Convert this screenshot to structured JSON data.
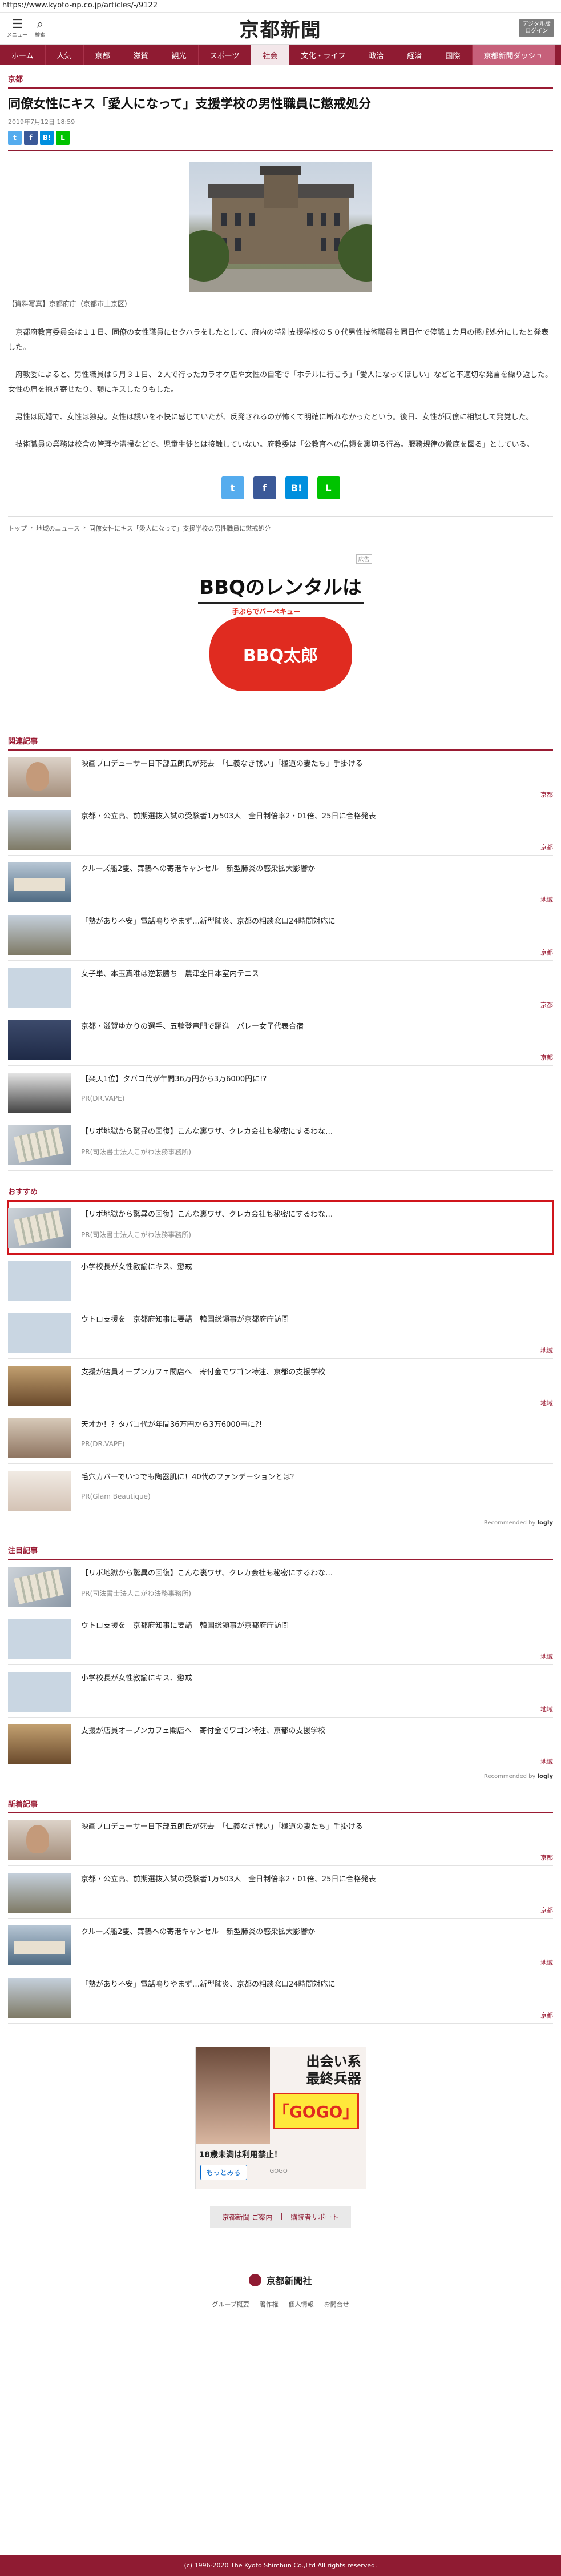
{
  "url": "https://www.kyoto-np.co.jp/articles/-/9122",
  "header": {
    "menu_label": "メニュー",
    "search_label": "検索",
    "logo": "京都新聞",
    "digital_label_1": "デジタル版",
    "digital_label_2": "ログイン"
  },
  "nav": [
    "ホーム",
    "人気",
    "京都",
    "滋賀",
    "観光",
    "スポーツ",
    "社会",
    "文化・ライフ",
    "政治",
    "経済",
    "国際",
    "京都新聞ダッシュ"
  ],
  "article": {
    "section": "京都",
    "title": "同僚女性にキス「愛人になって」支援学校の男性職員に懲戒処分",
    "date": "2019年7月12日 18:59",
    "caption": "【資料写真】京都府庁（京都市上京区）",
    "paragraphs": [
      "京都府教育委員会は１１日、同僚の女性職員にセクハラをしたとして、府内の特別支援学校の５０代男性技術職員を同日付で停職１カ月の懲戒処分にしたと発表した。",
      "府教委によると、男性職員は５月３１日、２人で行ったカラオケ店や女性の自宅で「ホテルに行こう」「愛人になってほしい」などと不適切な発言を繰り返した。女性の肩を抱き寄せたり、額にキスしたりもした。",
      "男性は既婚で、女性は独身。女性は誘いを不快に感じていたが、反発されるのが怖くて明確に断れなかったという。後日、女性が同僚に相談して発覚した。",
      "技術職員の業務は校舎の管理や清掃などで、児童生徒とは接触していない。府教委は「公教育への信頼を裏切る行為。服務規律の徹底を図る」としている。"
    ]
  },
  "share_small": [
    "t",
    "f",
    "B!",
    "L"
  ],
  "share_large": [
    "t",
    "f",
    "B!",
    "L"
  ],
  "breadcrumb": [
    "トップ",
    "地域のニュース",
    "同僚女性にキス「愛人になって」支援学校の男性職員に懲戒処分"
  ],
  "ad1": {
    "label": "広告",
    "title": "BBQのレンタルは",
    "logo_sub": "手ぶらでバーベキュー",
    "logo": "BBQ太郎"
  },
  "related": {
    "title": "関連記事",
    "items": [
      {
        "title": "映画プロデューサー日下部五朗氏が死去　「仁義なき戦い」「極道の妻たち」手掛ける",
        "tag": "京都"
      },
      {
        "title": "京都・公立高、前期選抜入試の受験者1万503人　全日制倍率2・01倍、25日に合格発表",
        "tag": "京都"
      },
      {
        "title": "クルーズ船2隻、舞鶴への寄港キャンセル　新型肺炎の感染拡大影響か",
        "tag": "地域"
      },
      {
        "title": "「熱があり不安」電話鳴りやまず…新型肺炎、京都の相談窓口24時間対応に",
        "tag": "京都"
      },
      {
        "title": "女子単、本玉真唯は逆転勝ち　農津全日本室内テニス",
        "tag": "京都"
      },
      {
        "title": "京都・滋賀ゆかりの選手、五輪登竜門で躍進　バレー女子代表合宿",
        "tag": "京都"
      },
      {
        "title": "【楽天1位】タバコ代が年間36万円から3万6000円に!?",
        "pr": "PR(DR.VAPE)"
      },
      {
        "title": "【リボ地獄から驚異の回復】こんな裏ワザ、クレカ会社も秘密にするわな…",
        "pr": "PR(司法書士法人こがわ法務事務所)"
      }
    ]
  },
  "recommend": {
    "title": "おすすめ",
    "items": [
      {
        "title": "【リボ地獄から驚異の回復】こんな裏ワザ、クレカ会社も秘密にするわな…",
        "pr": "PR(司法書士法人こがわ法務事務所)"
      },
      {
        "title": "小学校長が女性教諭にキス、懲戒",
        "tag": ""
      },
      {
        "title": "ウトロ支援を　京都府知事に要請　韓国総領事が京都府庁訪問",
        "tag": "地域"
      },
      {
        "title": "支援が店員オープンカフェ閣店へ　寄付金でワゴン特注、京都の支援学校",
        "tag": "地域"
      },
      {
        "title": "天才か！？タバコ代が年間36万円から3万6000円に?!",
        "pr": "PR(DR.VAPE)"
      },
      {
        "title": "毛穴カバーでいつでも陶器肌に！40代のファンデーションとは？",
        "pr": "PR(Glam Beautique)"
      }
    ],
    "recommended_by": "Recommended by",
    "brand": "logly"
  },
  "attention": {
    "title": "注目記事",
    "items": [
      {
        "title": "【リボ地獄から驚異の回復】こんな裏ワザ、クレカ会社も秘密にするわな…",
        "pr": "PR(司法書士法人こがわ法務事務所)"
      },
      {
        "title": "ウトロ支援を　京都府知事に要請　韓国総領事が京都府庁訪問",
        "tag": "地域"
      },
      {
        "title": "小学校長が女性教諭にキス、懲戒",
        "tag": "地域"
      },
      {
        "title": "支援が店員オープンカフェ閣店へ　寄付金でワゴン特注、京都の支援学校",
        "tag": "地域"
      }
    ],
    "recommended_by": "Recommended by",
    "brand": "logly"
  },
  "latest": {
    "title": "新着記事",
    "items": [
      {
        "title": "映画プロデューサー日下部五朗氏が死去　「仁義なき戦い」「極道の妻たち」手掛ける",
        "tag": "京都"
      },
      {
        "title": "京都・公立高、前期選抜入試の受験者1万503人　全日制倍率2・01倍、25日に合格発表",
        "tag": "京都"
      },
      {
        "title": "クルーズ船2隻、舞鶴への寄港キャンセル　新型肺炎の感染拡大影響か",
        "tag": "地域"
      },
      {
        "title": "「熱があり不安」電話鳴りやまず…新型肺炎、京都の相談窓口24時間対応に",
        "tag": "京都"
      }
    ]
  },
  "ad2": {
    "title_1": "出会い系",
    "title_2": "最終兵器",
    "badge": "「GOGO」",
    "notice": "18歳未満は利用禁止！",
    "button": "もっとみる",
    "small": "GOGO"
  },
  "footer": {
    "links": [
      "京都新聞 ご案内",
      "購読者サポート"
    ],
    "logo": "京都新聞社",
    "nav": [
      "グループ概要",
      "著作権",
      "個人情報",
      "お問合せ"
    ],
    "copyright": "(c) 1996-2020 The Kyoto Shimbun Co.,Ltd All rights reserved."
  }
}
